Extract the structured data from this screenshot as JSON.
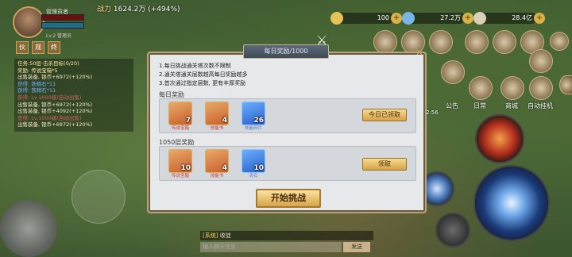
{
  "top": {
    "power_label": "战力",
    "power_value": "1624.2万 (+494%)",
    "gold": "100",
    "ingot": "27.2万",
    "silver": "28.4亿"
  },
  "player": {
    "name": "管理员者",
    "sub": "Lv.2 管理员"
  },
  "left_buttons": [
    "伙",
    "观",
    "终"
  ],
  "task": {
    "lines": [
      "任务:50层·击杀目标(0/20)",
      "奖励: 传说宝箱*5",
      "出售装备, 银币+6972(+120%)",
      "获得: 铁精石*11",
      "获得: 铁精石*11",
      "获得: Lv.1000级(自动出售)",
      "出售装备, 银币+6972(+120%)",
      "出售装备, 银币+4092(+120%)",
      "获得: Lv.1000级(自动出售)",
      "出售装备, 银币+6972(+120%)"
    ]
  },
  "right_icons": {
    "row2": [
      "公告",
      "日常",
      "商城",
      "自动挂机"
    ]
  },
  "timer": "2:56",
  "dialog": {
    "title": "每日奖励/1000",
    "rules": [
      "1.每日挑战通关塔次数不限制",
      "2.通关塔通关层数越高每日奖励越多",
      "3.首次通过指定层数, 更有丰厚奖励"
    ],
    "daily": {
      "label": "每日奖励",
      "items": [
        {
          "count": "7",
          "label": "传说宝箱",
          "icon": "chest-icon",
          "color": "orange"
        },
        {
          "count": "4",
          "label": "技能书",
          "icon": "book-icon",
          "color": "orange"
        },
        {
          "count": "26",
          "label": "技能碎片",
          "icon": "pouch-icon",
          "color": "blue"
        }
      ],
      "button": "今日已领取"
    },
    "milestone": {
      "label": "1050层奖励",
      "items": [
        {
          "count": "10",
          "label": "传说宝箱",
          "icon": "chest-icon",
          "color": "orange"
        },
        {
          "count": "4",
          "label": "技能书",
          "icon": "book-icon",
          "color": "orange"
        },
        {
          "count": "10",
          "label": "灵石",
          "icon": "sack-icon",
          "color": "blue"
        }
      ],
      "button": "领取"
    },
    "challenge": "开始挑战"
  },
  "chat": {
    "channel": "[系统]",
    "message": "收徒",
    "placeholder": "输入聊天信息",
    "send": "发送"
  }
}
